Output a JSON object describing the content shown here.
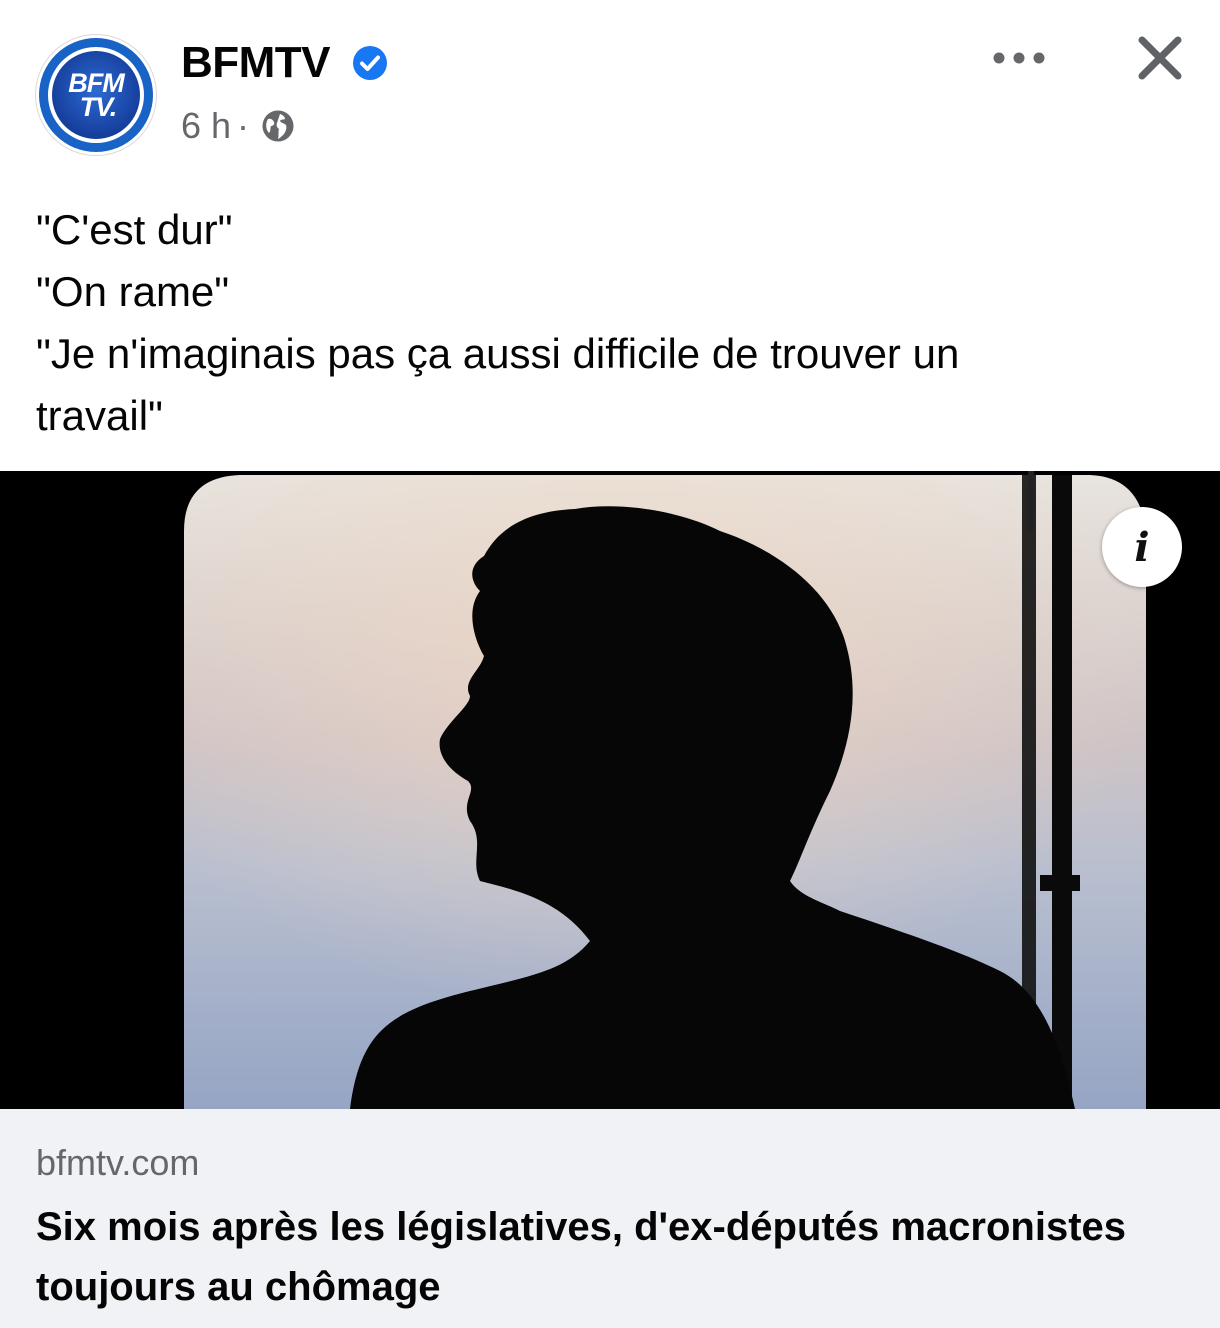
{
  "header": {
    "page_name": "BFMTV",
    "avatar_line1": "BFM",
    "avatar_line2": "TV.",
    "time": "6 h",
    "separator": "·",
    "audience_icon": "globe-icon",
    "verified_icon": "verified-badge-icon",
    "more_icon": "more-options-icon",
    "close_icon": "close-icon"
  },
  "post": {
    "lines": [
      "\"C'est dur\"",
      "\"On rame\"",
      "\"Je n'imaginais pas ça aussi difficile de trouver un",
      "travail\""
    ]
  },
  "media": {
    "info_label": "i",
    "info_icon": "info-icon"
  },
  "link": {
    "domain": "bfmtv.com",
    "title": "Six mois après les législatives, d'ex-députés macronistes toujours au chômage"
  },
  "colors": {
    "brand_blue": "#1a63c6",
    "verified_blue": "#1877f2",
    "secondary_text": "#65676b",
    "card_bg": "#f0f2f5"
  }
}
